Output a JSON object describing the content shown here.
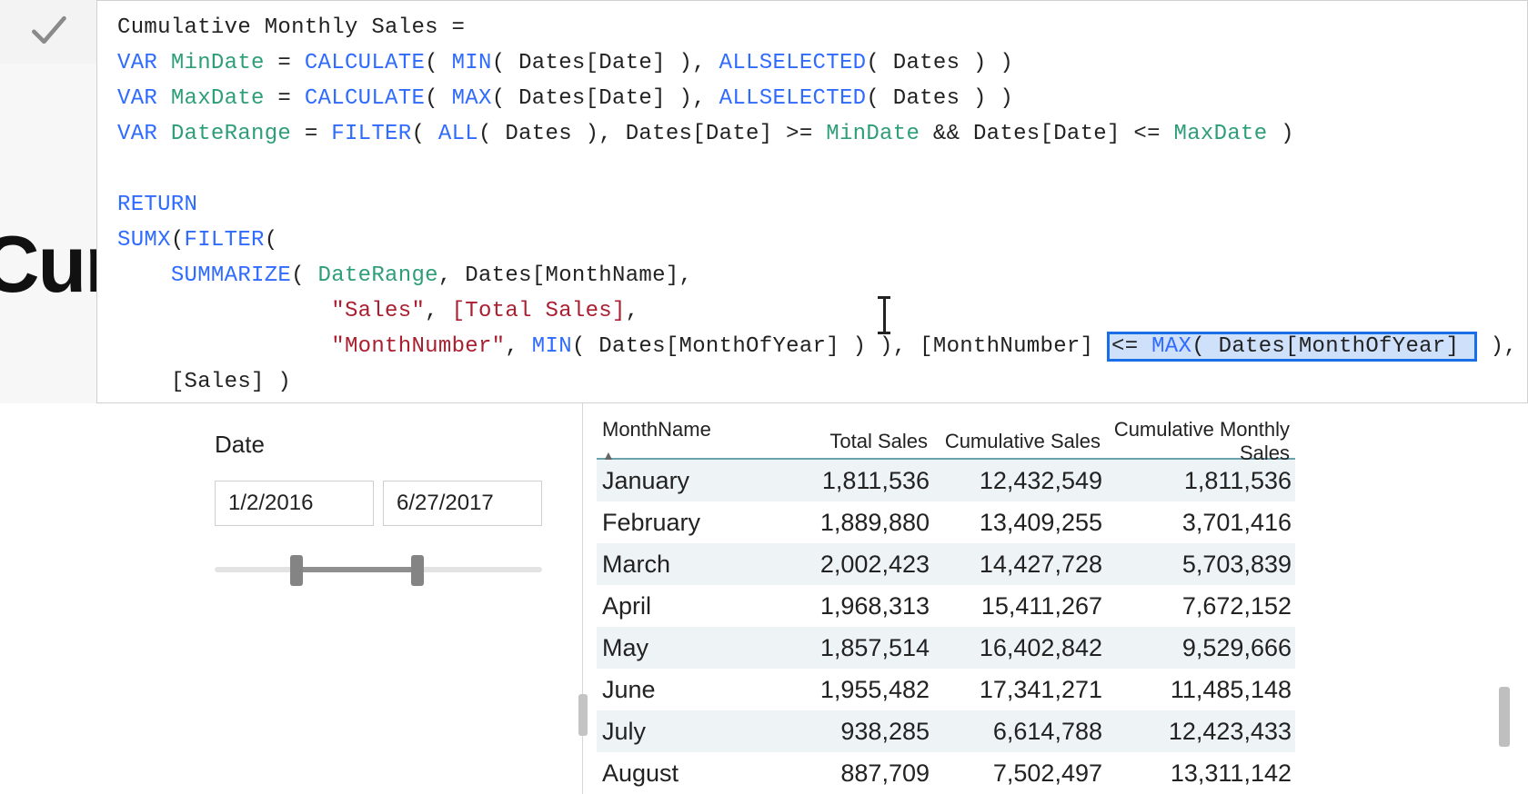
{
  "page": {
    "title_fragment": "Cum"
  },
  "formula": {
    "measure_name": "Cumulative Monthly Sales",
    "l1_kw_var": "VAR",
    "l1_var": "MinDate",
    "l1_eq": " = ",
    "l1_f1": "CALCULATE",
    "l1_p1": "( ",
    "l1_f2": "MIN",
    "l1_p2": "( Dates[Date] ), ",
    "l1_f3": "ALLSELECTED",
    "l1_p3": "( Dates ) )",
    "l2_kw_var": "VAR",
    "l2_var": "MaxDate",
    "l2_eq": " = ",
    "l2_f1": "CALCULATE",
    "l2_p1": "( ",
    "l2_f2": "MAX",
    "l2_p2": "( Dates[Date] ), ",
    "l2_f3": "ALLSELECTED",
    "l2_p3": "( Dates ) )",
    "l3_kw_var": "VAR",
    "l3_var": "DateRange",
    "l3_eq": " = ",
    "l3_f1": "FILTER",
    "l3_p1": "( ",
    "l3_f2": "ALL",
    "l3_p2": "( Dates ), Dates[Date] >= ",
    "l3_v1": "MinDate",
    "l3_and": " && ",
    "l3_p3": "Dates[Date] <= ",
    "l3_v2": "MaxDate",
    "l3_p4": " )",
    "l4_return": "RETURN",
    "l5_f1": "SUMX",
    "l5_p1": "(",
    "l5_f2": "FILTER",
    "l5_p2": "(",
    "l6_f1": "SUMMARIZE",
    "l6_p1": "( ",
    "l6_v1": "DateRange",
    "l6_p2": ", Dates[MonthName],",
    "l7_s1": "\"Sales\"",
    "l7_p1": ", ",
    "l7_m1": "[Total Sales]",
    "l7_p2": ",",
    "l8_s1": "\"MonthNumber\"",
    "l8_p1": ", ",
    "l8_f1": "MIN",
    "l8_p2": "( Dates[MonthOfYear] ) ), [MonthNumber] ",
    "l8_sel_op": "<= ",
    "l8_sel_f": "MAX",
    "l8_sel_p": "( Dates[MonthOfYear] ",
    "l8_tail": " ),",
    "l9": "[Sales] )"
  },
  "slicer": {
    "label": "Date",
    "start": "1/2/2016",
    "end": "6/27/2017",
    "fill_left_pct": 25,
    "fill_right_pct": 62
  },
  "table": {
    "columns": [
      "MonthName",
      "Total Sales",
      "Cumulative Sales",
      "Cumulative Monthly Sales"
    ],
    "sort_col": 0,
    "sort_dir": "asc",
    "rows": [
      {
        "month": "January",
        "total": "1,811,536",
        "cum": "12,432,549",
        "cms": "1,811,536"
      },
      {
        "month": "February",
        "total": "1,889,880",
        "cum": "13,409,255",
        "cms": "3,701,416"
      },
      {
        "month": "March",
        "total": "2,002,423",
        "cum": "14,427,728",
        "cms": "5,703,839"
      },
      {
        "month": "April",
        "total": "1,968,313",
        "cum": "15,411,267",
        "cms": "7,672,152"
      },
      {
        "month": "May",
        "total": "1,857,514",
        "cum": "16,402,842",
        "cms": "9,529,666"
      },
      {
        "month": "June",
        "total": "1,955,482",
        "cum": "17,341,271",
        "cms": "11,485,148"
      },
      {
        "month": "July",
        "total": "938,285",
        "cum": "6,614,788",
        "cms": "12,423,433"
      },
      {
        "month": "August",
        "total": "887,709",
        "cum": "7,502,497",
        "cms": "13,311,142"
      }
    ]
  }
}
